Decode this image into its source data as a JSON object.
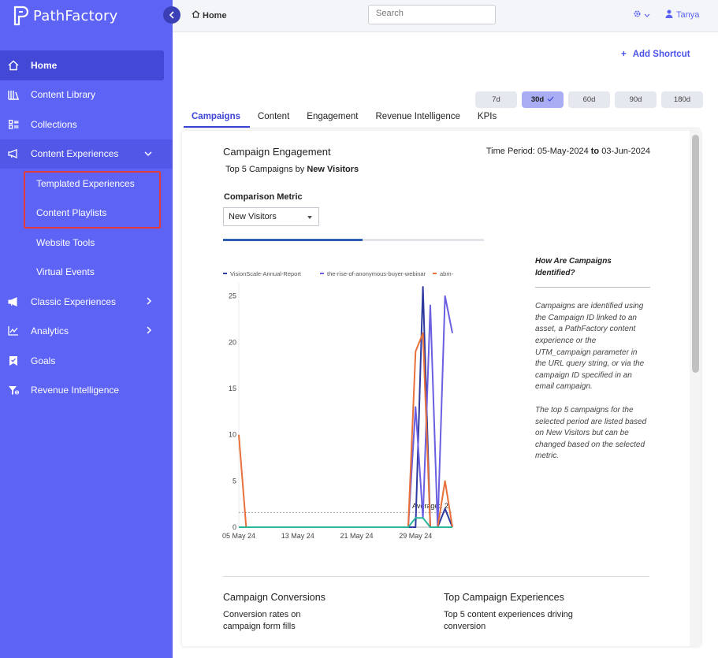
{
  "brand": {
    "name": "PathFactory",
    "sidebar_color": "#5c63f5",
    "accent": "#3c44d8"
  },
  "sidebar": {
    "items": [
      {
        "label": "Home",
        "icon": "home-icon",
        "active": true
      },
      {
        "label": "Content Library",
        "icon": "library-icon"
      },
      {
        "label": "Collections",
        "icon": "collections-icon"
      },
      {
        "label": "Content Experiences",
        "icon": "megaphone-icon",
        "expanded": true
      },
      {
        "label": "Templated Experiences",
        "sub": true
      },
      {
        "label": "Content Playlists",
        "sub": true
      },
      {
        "label": "Website Tools",
        "sub": true
      },
      {
        "label": "Virtual Events",
        "sub": true
      },
      {
        "label": "Classic Experiences",
        "icon": "megaphone-icon"
      },
      {
        "label": "Analytics",
        "icon": "analytics-icon"
      },
      {
        "label": "Goals",
        "icon": "goals-icon"
      },
      {
        "label": "Revenue Intelligence",
        "icon": "revenue-icon"
      }
    ]
  },
  "topbar": {
    "breadcrumb": "Home",
    "search_placeholder": "Search",
    "user": "Tanya"
  },
  "main": {
    "add_shortcut": "Add Shortcut",
    "periods": [
      {
        "label": "7d"
      },
      {
        "label": "30d",
        "selected": true
      },
      {
        "label": "60d"
      },
      {
        "label": "90d"
      },
      {
        "label": "180d"
      }
    ],
    "tabs": [
      "Campaigns",
      "Content",
      "Engagement",
      "Revenue Intelligence",
      "KPIs"
    ],
    "active_tab": "Campaigns"
  },
  "campaign_engagement": {
    "title": "Campaign Engagement",
    "subtitle_prefix": "Top 5 Campaigns by",
    "subtitle_metric": "New Visitors",
    "time_period_label": "Time Period:",
    "time_from": "05-May-2024",
    "time_to_label": "to",
    "time_to": "03-Jun-2024",
    "comparison_label": "Comparison Metric",
    "comparison_value": "New Visitors"
  },
  "chart_data": {
    "type": "line",
    "x": [
      "05 May 24",
      "06 May 24",
      "07 May 24",
      "08 May 24",
      "09 May 24",
      "10 May 24",
      "11 May 24",
      "12 May 24",
      "13 May 24",
      "14 May 24",
      "15 May 24",
      "16 May 24",
      "17 May 24",
      "18 May 24",
      "19 May 24",
      "20 May 24",
      "21 May 24",
      "22 May 24",
      "23 May 24",
      "24 May 24",
      "25 May 24",
      "26 May 24",
      "27 May 24",
      "28 May 24",
      "29 May 24",
      "30 May 24",
      "31 May 24",
      "01 Jun 24",
      "02 Jun 24",
      "03 Jun 24"
    ],
    "xticks": [
      "05 May 24",
      "13 May 24",
      "21 May 24",
      "29 May 24"
    ],
    "ylim": [
      0,
      26
    ],
    "yticks": [
      0,
      5,
      10,
      15,
      20,
      25
    ],
    "series": [
      {
        "name": "VisionScale-Annual-Report",
        "color": "#2f3a9e",
        "values": [
          0,
          0,
          0,
          0,
          0,
          0,
          0,
          0,
          0,
          0,
          0,
          0,
          0,
          0,
          0,
          0,
          0,
          0,
          0,
          0,
          0,
          0,
          0,
          0,
          0,
          26,
          0,
          0,
          2,
          0
        ]
      },
      {
        "name": "the-rise-of-anonymous-buyer-webinar",
        "color": "#6a5fe0",
        "values": [
          0,
          0,
          0,
          0,
          0,
          0,
          0,
          0,
          0,
          0,
          0,
          0,
          0,
          0,
          0,
          0,
          0,
          0,
          0,
          0,
          0,
          0,
          0,
          0,
          13,
          1,
          24,
          0,
          25,
          21
        ]
      },
      {
        "name": "abm-",
        "color": "#e8703a",
        "values": [
          10,
          0,
          0,
          0,
          0,
          0,
          0,
          0,
          0,
          0,
          0,
          0,
          0,
          0,
          0,
          0,
          0,
          0,
          0,
          0,
          0,
          0,
          0,
          0,
          19,
          21,
          0,
          0,
          5,
          0
        ]
      },
      {
        "name": "",
        "color": "#2bb59a",
        "values": [
          0,
          0,
          0,
          0,
          0,
          0,
          0,
          0,
          0,
          0,
          0,
          0,
          0,
          0,
          0,
          0,
          0,
          0,
          0,
          0,
          0,
          0,
          0,
          0,
          1,
          1,
          0,
          0,
          0,
          0
        ]
      }
    ],
    "average": {
      "label": "Average:: 2",
      "value": 1.6
    }
  },
  "info": {
    "heading": "How Are Campaigns Identified?",
    "p1": "Campaigns are identified using the Campaign ID linked to an asset, a PathFactory content experience or the UTM_campaign parameter in the URL query string, or via the campaign ID specified in an email campaign.",
    "p2": "The top 5 campaigns for the selected period are listed based on New Visitors but can be changed based on the selected metric."
  },
  "campaign_conversions": {
    "title": "Campaign Conversions",
    "subtitle": "Conversion rates on campaign form fills"
  },
  "top_experiences": {
    "title": "Top Campaign Experiences",
    "subtitle": "Top 5 content experiences driving conversion"
  }
}
